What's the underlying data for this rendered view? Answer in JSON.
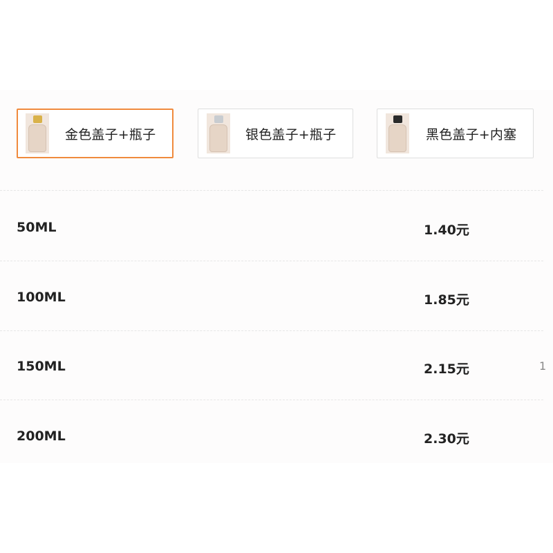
{
  "options": [
    {
      "label": "金色盖子+瓶子",
      "selected": true,
      "thumb_icon": "gold-cap-bottle-icon",
      "cap_color": "#d9b24a"
    },
    {
      "label": "银色盖子+瓶子",
      "selected": false,
      "thumb_icon": "silver-cap-bottle-icon",
      "cap_color": "#c8ccd0"
    },
    {
      "label": "黑色盖子+内塞",
      "selected": false,
      "thumb_icon": "black-cap-bottle-icon",
      "cap_color": "#2a2a2a"
    }
  ],
  "prices": [
    {
      "size": "50ML",
      "price": "1.40元"
    },
    {
      "size": "100ML",
      "price": "1.85元"
    },
    {
      "size": "150ML",
      "price": "2.15元",
      "edge_text": "1"
    },
    {
      "size": "200ML",
      "price": "2.30元"
    }
  ],
  "colors": {
    "selected_border": "#f08a3c",
    "border": "#dedede",
    "divider": "#e6e6e6",
    "text": "#222222"
  }
}
